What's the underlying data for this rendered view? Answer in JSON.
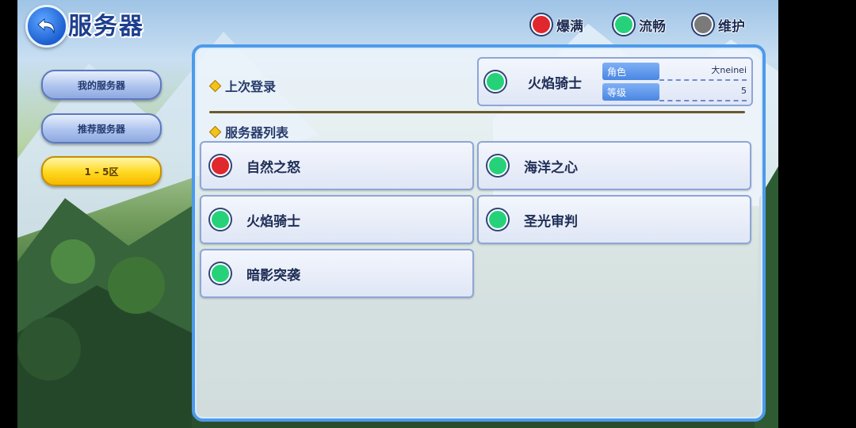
{
  "header": {
    "title": "服务器",
    "back_icon": "back-arrow-icon"
  },
  "sidebar": {
    "items": [
      {
        "label": "我的服务器",
        "active": false
      },
      {
        "label": "推荐服务器",
        "active": false
      },
      {
        "label": "1 – 5区",
        "active": true
      }
    ]
  },
  "legend": [
    {
      "label": "爆满",
      "color": "#e0272d"
    },
    {
      "label": "流畅",
      "color": "#25d27a"
    },
    {
      "label": "维护",
      "color": "#7a7a7a"
    }
  ],
  "last_login": {
    "label": "上次登录",
    "server": {
      "name": "火焰骑士",
      "status_color": "#25d27a"
    },
    "role_key": "角色",
    "role_value": "大neinei",
    "level_key": "等级",
    "level_value": "5"
  },
  "server_list": {
    "label": "服务器列表",
    "servers": [
      {
        "name": "自然之怒",
        "status_color": "#e0272d"
      },
      {
        "name": "海洋之心",
        "status_color": "#25d27a"
      },
      {
        "name": "火焰骑士",
        "status_color": "#25d27a"
      },
      {
        "name": "圣光审判",
        "status_color": "#25d27a"
      },
      {
        "name": "暗影突袭",
        "status_color": "#25d27a"
      }
    ]
  }
}
